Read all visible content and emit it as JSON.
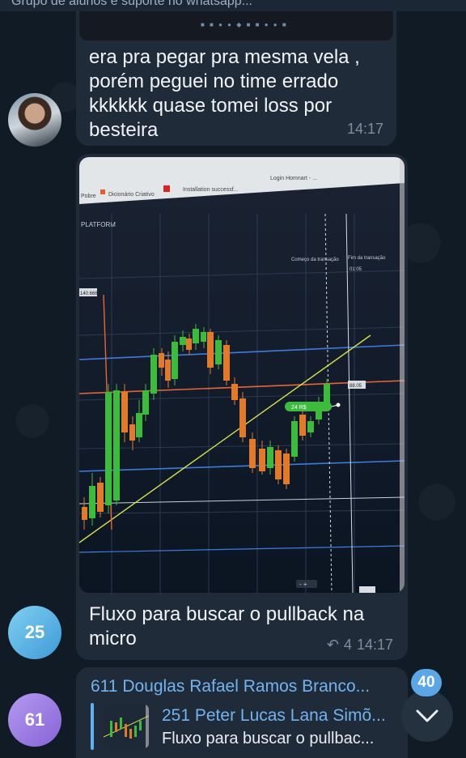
{
  "chat": {
    "title": "Grupo de alunos e suporte no whatsapp..."
  },
  "messages": [
    {
      "text": "era pra pegar pra mesma vela , porém peguei no time errado kkkkkk quase tomei loss por besteira",
      "time": "14:17"
    },
    {
      "caption": "Fluxo para buscar o pullback na micro",
      "replies": "4",
      "time": "14:17",
      "avatar_label": "25",
      "photo": {
        "tabs": [
          "Pobre",
          "Dicionário Criativo",
          "Installation successf...",
          "Login Homnart - ..."
        ],
        "platform_label": "PLATFORM",
        "start_label": "Começo da transação",
        "end_label": "Fim da transação",
        "end_time": "01:05",
        "trade_label": "24 R$",
        "price_left": "140.666",
        "price_right": "88.05"
      }
    },
    {
      "sender": "611 Douglas Rafael Ramos Branco...",
      "avatar_label": "61",
      "reply_to_name": "251 Peter Lucas Lana Simõ...",
      "reply_to_text": "Fluxo para buscar o pullbac..."
    }
  ],
  "unread_badge": "40",
  "icons": {
    "reply": "reply-icon",
    "scroll_down": "chevron-down-icon"
  },
  "colors": {
    "bubble": "#1f2b38",
    "accent": "#73b3f0",
    "candle_up": "#3dbb3d",
    "candle_down": "#e27a2a"
  }
}
